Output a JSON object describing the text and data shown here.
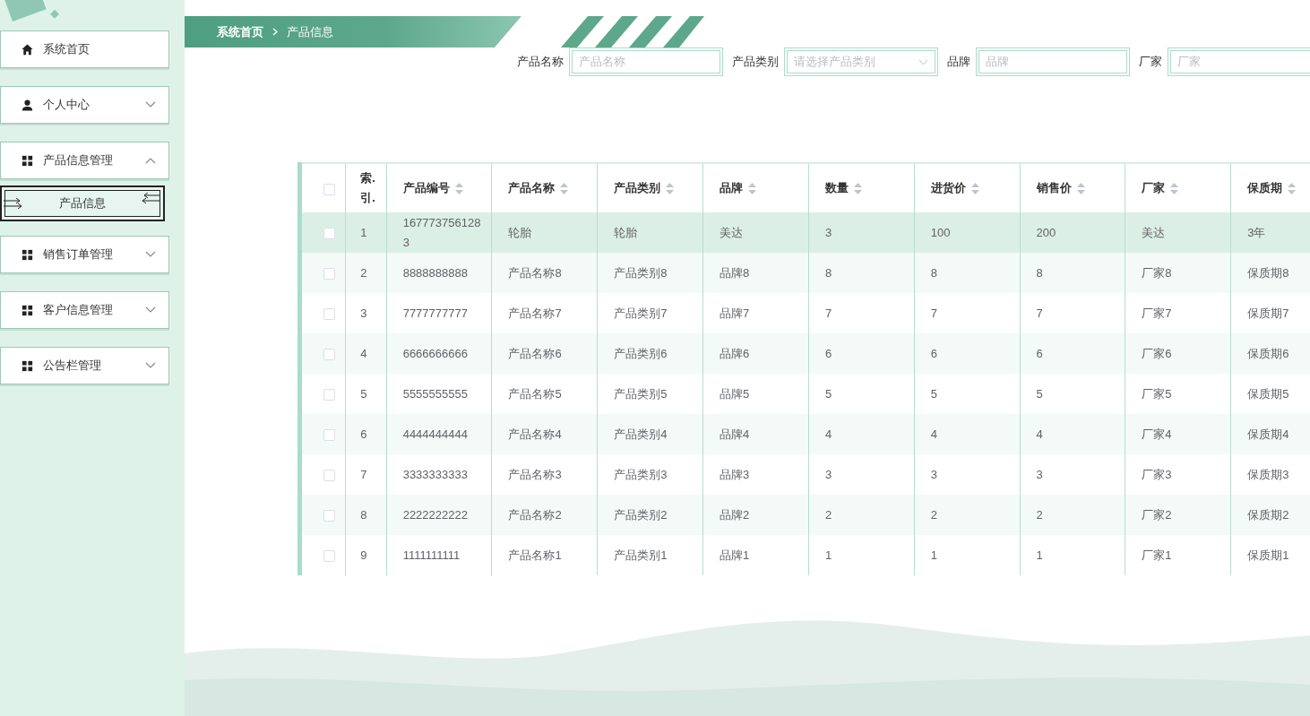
{
  "sidebar": {
    "items": [
      {
        "label": "系统首页",
        "kind": "link"
      },
      {
        "label": "个人中心",
        "kind": "menu",
        "expanded": false
      },
      {
        "label": "产品信息管理",
        "kind": "menu",
        "expanded": true,
        "children": [
          {
            "label": "产品信息",
            "selected": true
          }
        ]
      },
      {
        "label": "销售订单管理",
        "kind": "menu",
        "expanded": false
      },
      {
        "label": "客户信息管理",
        "kind": "menu",
        "expanded": false
      },
      {
        "label": "公告栏管理",
        "kind": "menu",
        "expanded": false
      }
    ]
  },
  "breadcrumb": [
    "系统首页",
    "产品信息"
  ],
  "filters": [
    {
      "label": "产品名称",
      "placeholder": "产品名称",
      "kind": "text"
    },
    {
      "label": "产品类别",
      "placeholder": "请选择产品类别",
      "kind": "select"
    },
    {
      "label": "品牌",
      "placeholder": "品牌",
      "kind": "text"
    },
    {
      "label": "厂家",
      "placeholder": "厂家",
      "kind": "text"
    }
  ],
  "table": {
    "select_all_checked": false,
    "columns": [
      {
        "label": "索.引."
      },
      {
        "label": "产品编号"
      },
      {
        "label": "产品名称"
      },
      {
        "label": "产品类别"
      },
      {
        "label": "品牌"
      },
      {
        "label": "数量"
      },
      {
        "label": "进货价"
      },
      {
        "label": "销售价"
      },
      {
        "label": "厂家"
      },
      {
        "label": "保质期"
      }
    ],
    "rows": [
      {
        "checked": false,
        "highlighted": true,
        "cells": [
          "1",
          "1677737561283",
          "轮胎",
          "轮胎",
          "美达",
          "3",
          "100",
          "200",
          "美达",
          "3年"
        ]
      },
      {
        "checked": false,
        "highlighted": false,
        "cells": [
          "2",
          "8888888888",
          "产品名称8",
          "产品类别8",
          "品牌8",
          "8",
          "8",
          "8",
          "厂家8",
          "保质期8"
        ]
      },
      {
        "checked": false,
        "highlighted": false,
        "cells": [
          "3",
          "7777777777",
          "产品名称7",
          "产品类别7",
          "品牌7",
          "7",
          "7",
          "7",
          "厂家7",
          "保质期7"
        ]
      },
      {
        "checked": false,
        "highlighted": false,
        "cells": [
          "4",
          "6666666666",
          "产品名称6",
          "产品类别6",
          "品牌6",
          "6",
          "6",
          "6",
          "厂家6",
          "保质期6"
        ]
      },
      {
        "checked": false,
        "highlighted": false,
        "cells": [
          "5",
          "5555555555",
          "产品名称5",
          "产品类别5",
          "品牌5",
          "5",
          "5",
          "5",
          "厂家5",
          "保质期5"
        ]
      },
      {
        "checked": false,
        "highlighted": false,
        "cells": [
          "6",
          "4444444444",
          "产品名称4",
          "产品类别4",
          "品牌4",
          "4",
          "4",
          "4",
          "厂家4",
          "保质期4"
        ]
      },
      {
        "checked": false,
        "highlighted": false,
        "cells": [
          "7",
          "3333333333",
          "产品名称3",
          "产品类别3",
          "品牌3",
          "3",
          "3",
          "3",
          "厂家3",
          "保质期3"
        ]
      },
      {
        "checked": false,
        "highlighted": false,
        "cells": [
          "8",
          "2222222222",
          "产品名称2",
          "产品类别2",
          "品牌2",
          "2",
          "2",
          "2",
          "厂家2",
          "保质期2"
        ]
      },
      {
        "checked": false,
        "highlighted": false,
        "cells": [
          "9",
          "1111111111",
          "产品名称1",
          "产品类别1",
          "品牌1",
          "1",
          "1",
          "1",
          "厂家1",
          "保质期1"
        ]
      }
    ]
  }
}
